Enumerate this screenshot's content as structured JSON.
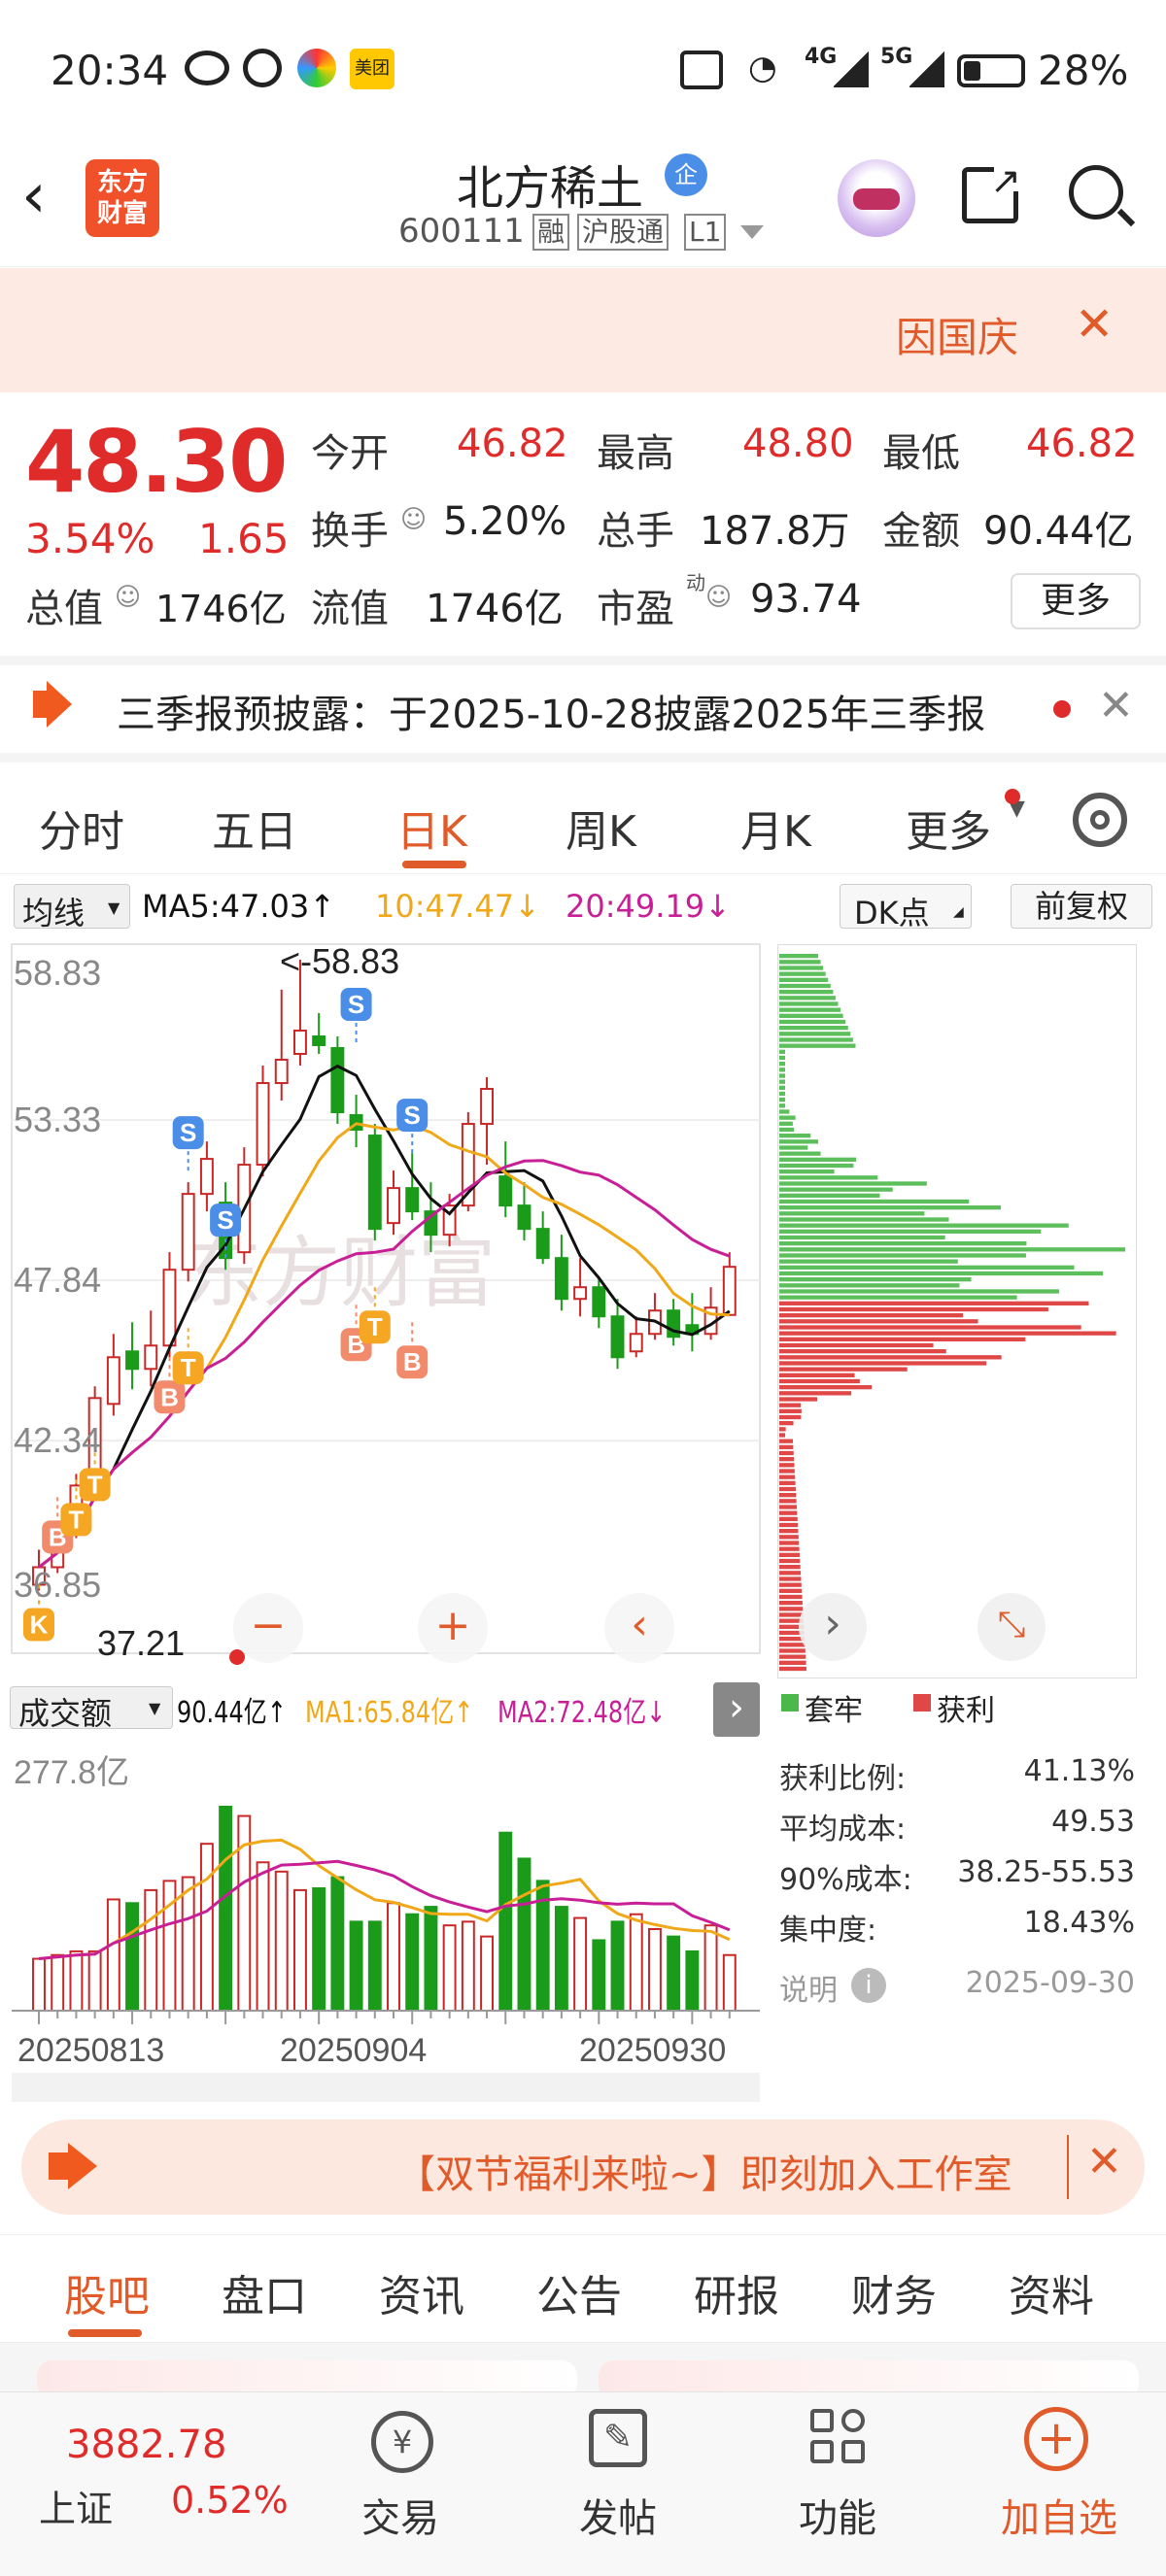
{
  "status": {
    "time": "20:34",
    "network1": "4G",
    "network2": "5G",
    "battery": "28%",
    "app_badge": "美团"
  },
  "header": {
    "name": "北方稀土",
    "badge": "企",
    "code": "600111",
    "tags": [
      "融",
      "沪股通",
      "L1"
    ],
    "logo_line1": "东方",
    "logo_line2": "财富"
  },
  "notice": {
    "text": "因国庆"
  },
  "quote": {
    "price": "48.30",
    "pct": "3.54%",
    "chg": "1.65",
    "rows": [
      [
        {
          "label": "今开",
          "value": "46.82"
        },
        {
          "label": "最高",
          "value": "48.80"
        },
        {
          "label": "最低",
          "value": "46.82"
        }
      ],
      [
        {
          "label": "换手",
          "value": "5.20%"
        },
        {
          "label": "总手",
          "value": "187.8万"
        },
        {
          "label": "金额",
          "value": "90.44亿"
        }
      ],
      [
        {
          "label": "总值",
          "value": "1746亿"
        },
        {
          "label": "流值",
          "value": "1746亿"
        },
        {
          "label": "市盈",
          "value": "93.74"
        }
      ]
    ],
    "pe_sup": "动",
    "more_label": "更多"
  },
  "announce": {
    "text": "三季报预披露：于2025-10-28披露2025年三季报"
  },
  "tabs": {
    "items": [
      "分时",
      "五日",
      "日K",
      "周K",
      "月K",
      "更多"
    ],
    "active": 2
  },
  "kline": {
    "ma_label": "均线",
    "ma5": "MA5:47.03↑",
    "ma10": "10:47.47↓",
    "ma20": "20:49.19↓",
    "dk_label": "DK点",
    "adj_label": "前复权",
    "y_ticks": [
      "58.83",
      "53.33",
      "47.84",
      "42.34",
      "36.85"
    ],
    "high_label": "<-58.83",
    "low_label": "37.21",
    "watermark": "东方财富",
    "colors": {
      "up": "#c82828",
      "down": "#1a9b1a",
      "ma5": "#111111",
      "ma10": "#f0a818",
      "ma20": "#c81e96"
    }
  },
  "chips": {
    "legend_trapped": "套牢",
    "legend_profit": "获利",
    "stats": [
      {
        "label": "获利比例:",
        "value": "41.13%"
      },
      {
        "label": "平均成本:",
        "value": "49.53"
      },
      {
        "label": "90%成本:",
        "value": "38.25-55.53"
      },
      {
        "label": "集中度:",
        "value": "18.43%"
      }
    ],
    "note_label": "说明",
    "date": "2025-09-30"
  },
  "volume": {
    "label": "成交额",
    "current": "90.44亿↑",
    "ma1": "MA1:65.84亿↑",
    "ma2": "MA2:72.48亿↓",
    "max": "277.8亿",
    "dates": [
      "20250813",
      "20250904",
      "20250930"
    ]
  },
  "promo": {
    "text": "【双节福利来啦~】即刻加入工作室"
  },
  "subtabs": {
    "items": [
      "股吧",
      "盘口",
      "资讯",
      "公告",
      "研报",
      "财务",
      "资料"
    ],
    "active": 0
  },
  "bottom": {
    "index_value": "3882.78",
    "index_name": "上证",
    "index_pct": "0.52%",
    "items": [
      {
        "label": "交易",
        "icon": "yuan-exchange-icon"
      },
      {
        "label": "发帖",
        "icon": "edit-icon"
      },
      {
        "label": "功能",
        "icon": "grid-icon"
      },
      {
        "label": "加自选",
        "icon": "plus-circle-icon"
      }
    ]
  }
}
